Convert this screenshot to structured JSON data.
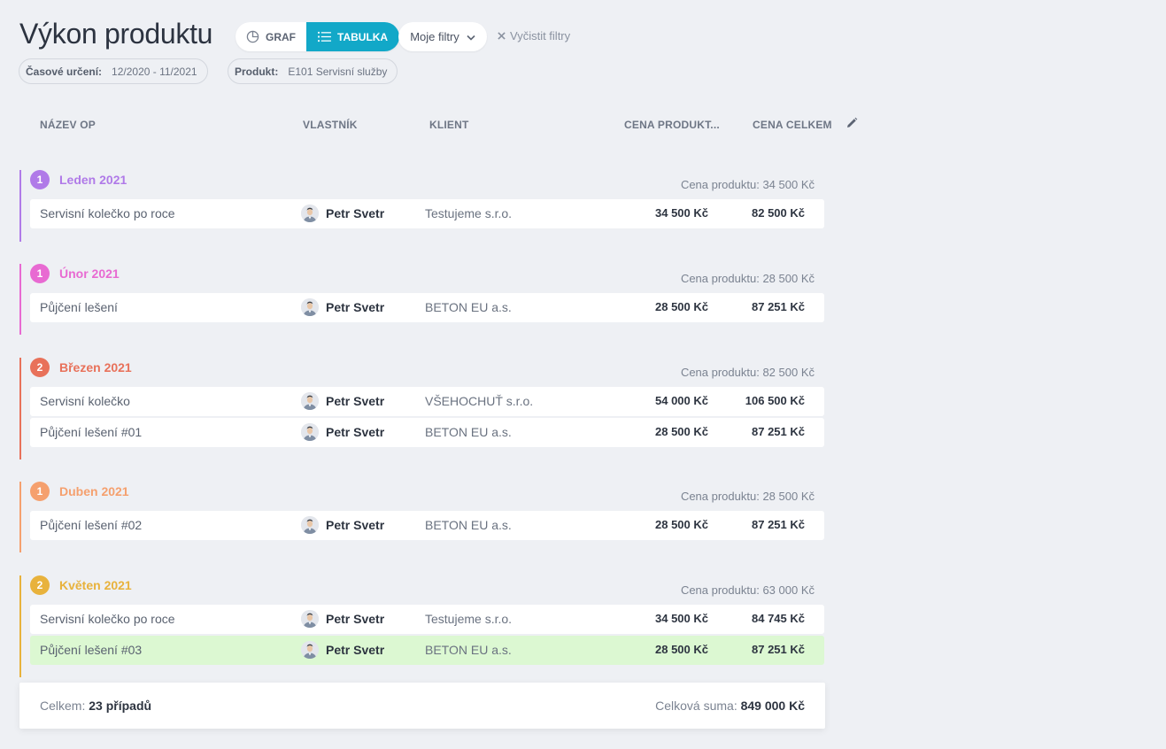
{
  "header": {
    "title": "Výkon produktu",
    "view_graph": "GRAF",
    "view_table": "TABULKA",
    "my_filters": "Moje filtry",
    "clear_filters": "Vyčistit filtry"
  },
  "chips": {
    "period_label": "Časové určení:",
    "period_value": "12/2020 - 11/2021",
    "product_label": "Produkt:",
    "product_value": "E101 Servisní služby"
  },
  "columns": {
    "name": "NÁZEV OP",
    "owner": "VLASTNÍK",
    "client": "KLIENT",
    "product_price": "CENA PRODUKT...",
    "total_price": "CENA CELKEM"
  },
  "colors": {
    "accent": "#12a8c8",
    "leden": "#b07ae8",
    "unor": "#e86ad2",
    "brezen": "#e8715a",
    "duben": "#f5a06e",
    "kveten": "#e8b23c",
    "highlight_row": "#dcf8d2"
  },
  "groups": [
    {
      "count": "1",
      "title": "Leden 2021",
      "sum": "Cena produktu: 34 500 Kč",
      "rows": [
        {
          "name": "Servisní kolečko po roce",
          "owner": "Petr Svetr",
          "client": "Testujeme s.r.o.",
          "price": "34 500 Kč",
          "total": "82 500 Kč"
        }
      ]
    },
    {
      "count": "1",
      "title": "Únor 2021",
      "sum": "Cena produktu: 28 500 Kč",
      "rows": [
        {
          "name": "Půjčení lešení",
          "owner": "Petr Svetr",
          "client": "BETON EU a.s.",
          "price": "28 500 Kč",
          "total": "87 251 Kč"
        }
      ]
    },
    {
      "count": "2",
      "title": "Březen 2021",
      "sum": "Cena produktu: 82 500 Kč",
      "rows": [
        {
          "name": "Servisní kolečko",
          "owner": "Petr Svetr",
          "client": "VŠEHOCHUŤ s.r.o.",
          "price": "54 000 Kč",
          "total": "106 500 Kč"
        },
        {
          "name": "Půjčení lešení #01",
          "owner": "Petr Svetr",
          "client": "BETON EU a.s.",
          "price": "28 500 Kč",
          "total": "87 251 Kč"
        }
      ]
    },
    {
      "count": "1",
      "title": "Duben 2021",
      "sum": "Cena produktu: 28 500 Kč",
      "rows": [
        {
          "name": "Půjčení lešení #02",
          "owner": "Petr Svetr",
          "client": "BETON EU a.s.",
          "price": "28 500 Kč",
          "total": "87 251 Kč"
        }
      ]
    },
    {
      "count": "2",
      "title": "Květen 2021",
      "sum": "Cena produktu: 63 000 Kč",
      "rows": [
        {
          "name": "Servisní kolečko po roce",
          "owner": "Petr Svetr",
          "client": "Testujeme s.r.o.",
          "price": "34 500 Kč",
          "total": "84 745 Kč"
        },
        {
          "name": "Půjčení lešení #03",
          "owner": "Petr Svetr",
          "client": "BETON EU a.s.",
          "price": "28 500 Kč",
          "total": "87 251 Kč",
          "highlighted": true
        }
      ]
    }
  ],
  "footer": {
    "count_label": "Celkem:",
    "count_value": "23 případů",
    "sum_label": "Celková suma:",
    "sum_value": "849 000 Kč"
  }
}
